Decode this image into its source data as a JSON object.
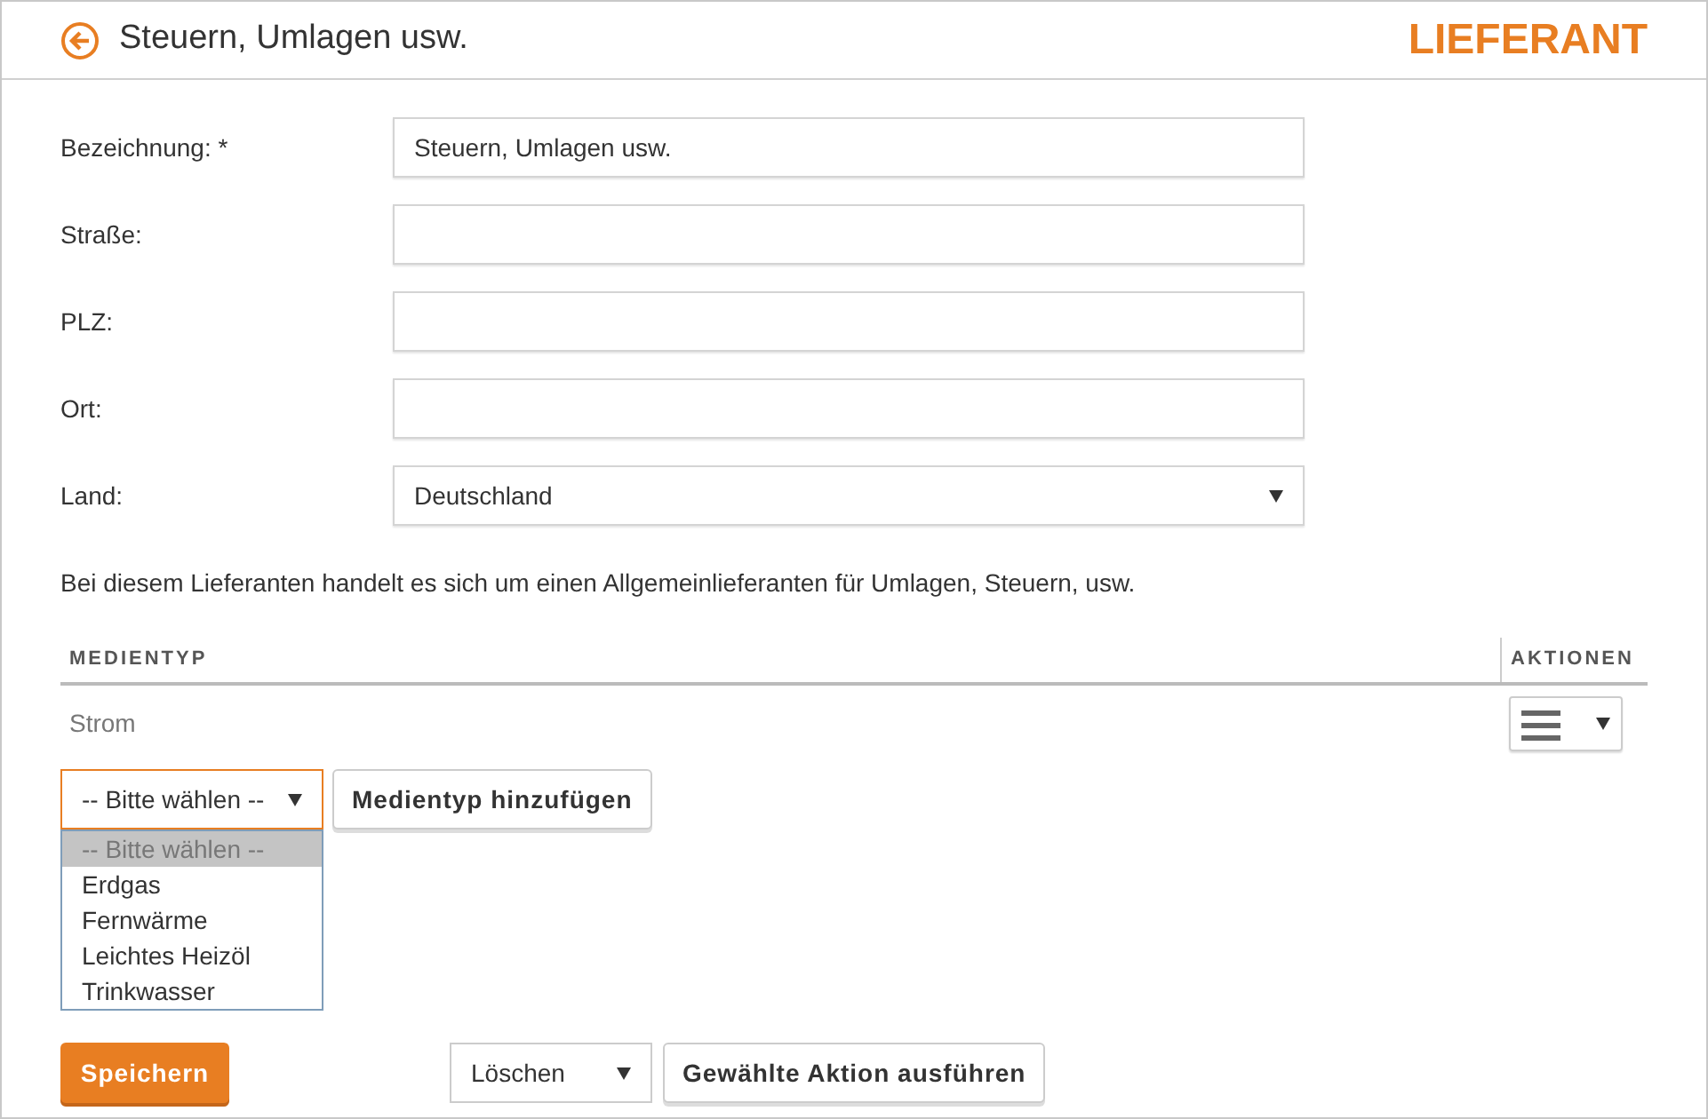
{
  "header": {
    "title": "Steuern, Umlagen usw.",
    "section": "LIEFERANT"
  },
  "form": {
    "fields": [
      {
        "label": "Bezeichnung: *",
        "kind": "text",
        "value": "Steuern, Umlagen usw."
      },
      {
        "label": "Straße:",
        "kind": "text"
      },
      {
        "label": "PLZ:",
        "kind": "text"
      },
      {
        "label": "Ort:",
        "kind": "text"
      },
      {
        "label": "Land:",
        "kind": "select",
        "value": "Deutschland"
      }
    ]
  },
  "note": "Bei diesem Lieferanten handelt es sich um einen Allgemeinlieferanten für Umlagen, Steuern, usw.",
  "table": {
    "columns": [
      "MEDIENTYP",
      "AKTIONEN"
    ],
    "rows": [
      {
        "medientyp": "Strom"
      }
    ]
  },
  "add": {
    "select": {
      "value": "-- Bitte wählen --",
      "expanded": true,
      "options": [
        {
          "label": "-- Bitte wählen --",
          "selected": true
        },
        {
          "label": "Erdgas",
          "selected": false
        },
        {
          "label": "Fernwärme",
          "selected": false
        },
        {
          "label": "Leichtes Heizöl",
          "selected": false
        },
        {
          "label": "Trinkwasser",
          "selected": false
        }
      ]
    },
    "button": "Medientyp hinzufügen"
  },
  "footer": {
    "save": "Speichern",
    "action_select": "Löschen",
    "run": "Gewählte Aktion ausführen"
  }
}
